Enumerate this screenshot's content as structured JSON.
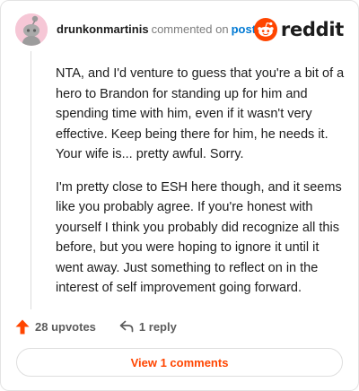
{
  "header": {
    "username": "drunkonmartinis",
    "verb": "commented on",
    "post_link": "post",
    "brand_word": "reddit"
  },
  "comment": {
    "paragraphs": [
      "NTA, and I'd venture to guess that you're a bit of a hero to Brandon for standing up for him and spending time with him, even if it wasn't very effective. Keep being there for him, he needs it. Your wife is... pretty awful. Sorry.",
      "I'm pretty close to ESH here though, and it seems like you probably agree. If you're honest with yourself I think you probably did recognize all this before, but you were hoping to ignore it until it went away. Just something to reflect on in the interest of self improvement going forward."
    ]
  },
  "actions": {
    "upvotes_label": "28 upvotes",
    "reply_label": "1 reply"
  },
  "footer": {
    "view_comments_label": "View 1 comments"
  },
  "colors": {
    "accent": "#ff4500",
    "link": "#0079d3",
    "avatar_bg": "#f6c7d6"
  },
  "icons": {
    "avatar": "snoo-avatar-icon",
    "brand": "reddit-logo-icon",
    "upvote": "upvote-arrow-icon",
    "reply": "reply-arrow-icon"
  }
}
